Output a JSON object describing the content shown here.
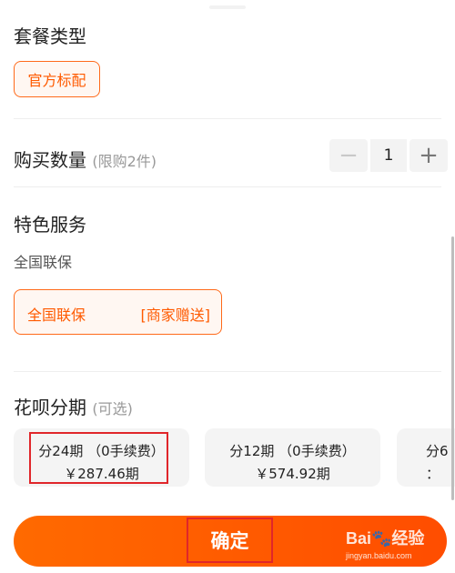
{
  "package": {
    "title": "套餐类型",
    "selected": "官方标配"
  },
  "quantity": {
    "title": "购买数量",
    "limit_note": "(限购2件)",
    "minus": "−",
    "value": "1",
    "plus": "+"
  },
  "services": {
    "title": "特色服务",
    "subtitle": "全国联保",
    "option_name": "全国联保",
    "option_tag": "[商家赠送]"
  },
  "installments": {
    "title": "花呗分期",
    "optional_note": "(可选)",
    "plans": [
      {
        "line1": "分24期 （0手续费）",
        "line2": "￥287.46期"
      },
      {
        "line1": "分12期 （0手续费）",
        "line2": "￥574.92期"
      },
      {
        "line1": "分6",
        "line2": "："
      }
    ]
  },
  "confirm": {
    "label": "确定"
  },
  "watermark": {
    "logo": "Bai🐾经验",
    "url": "jingyan.baidu.com"
  },
  "colors": {
    "accent": "#ff5a00",
    "highlight": "#e0262a"
  }
}
